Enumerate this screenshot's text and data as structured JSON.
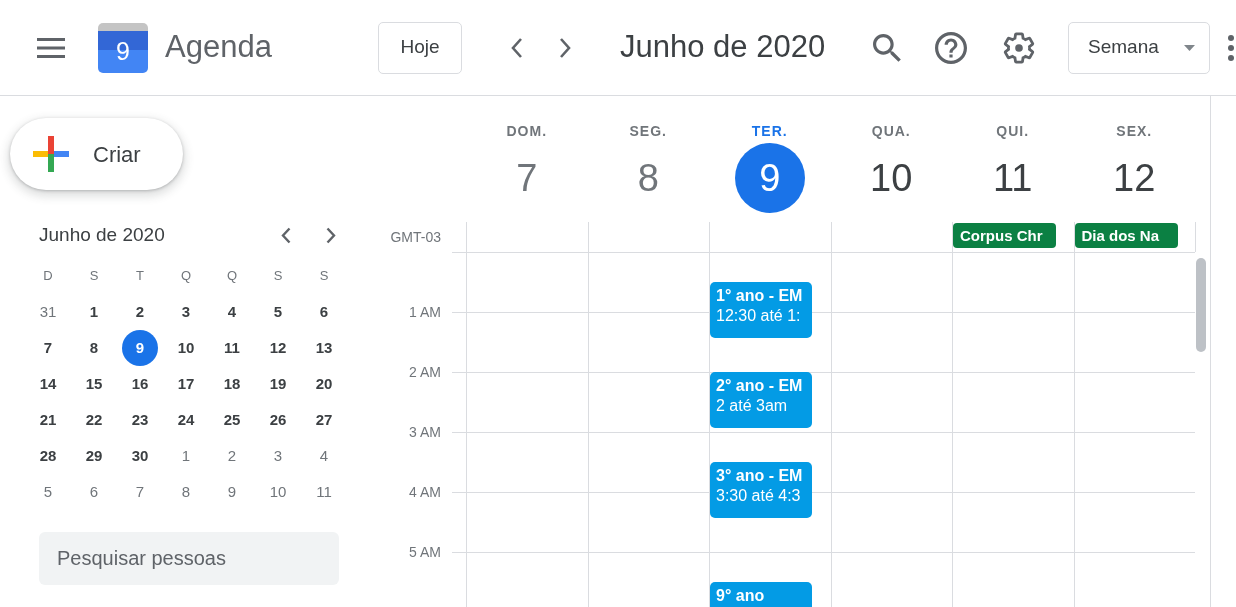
{
  "header": {
    "logo_day": "9",
    "app_name": "Agenda",
    "today_button": "Hoje",
    "period_title": "Junho de 2020",
    "view_select": "Semana"
  },
  "sidebar": {
    "create_button": "Criar",
    "mini_calendar": {
      "title": "Junho de 2020",
      "weekdays": [
        "D",
        "S",
        "T",
        "Q",
        "Q",
        "S",
        "S"
      ],
      "weeks": [
        [
          {
            "day": "31",
            "in_month": false,
            "selected": false
          },
          {
            "day": "1",
            "in_month": true,
            "selected": false
          },
          {
            "day": "2",
            "in_month": true,
            "selected": false
          },
          {
            "day": "3",
            "in_month": true,
            "selected": false
          },
          {
            "day": "4",
            "in_month": true,
            "selected": false
          },
          {
            "day": "5",
            "in_month": true,
            "selected": false
          },
          {
            "day": "6",
            "in_month": true,
            "selected": false
          }
        ],
        [
          {
            "day": "7",
            "in_month": true,
            "selected": false
          },
          {
            "day": "8",
            "in_month": true,
            "selected": false
          },
          {
            "day": "9",
            "in_month": true,
            "selected": true
          },
          {
            "day": "10",
            "in_month": true,
            "selected": false
          },
          {
            "day": "11",
            "in_month": true,
            "selected": false
          },
          {
            "day": "12",
            "in_month": true,
            "selected": false
          },
          {
            "day": "13",
            "in_month": true,
            "selected": false
          }
        ],
        [
          {
            "day": "14",
            "in_month": true,
            "selected": false
          },
          {
            "day": "15",
            "in_month": true,
            "selected": false
          },
          {
            "day": "16",
            "in_month": true,
            "selected": false
          },
          {
            "day": "17",
            "in_month": true,
            "selected": false
          },
          {
            "day": "18",
            "in_month": true,
            "selected": false
          },
          {
            "day": "19",
            "in_month": true,
            "selected": false
          },
          {
            "day": "20",
            "in_month": true,
            "selected": false
          }
        ],
        [
          {
            "day": "21",
            "in_month": true,
            "selected": false
          },
          {
            "day": "22",
            "in_month": true,
            "selected": false
          },
          {
            "day": "23",
            "in_month": true,
            "selected": false
          },
          {
            "day": "24",
            "in_month": true,
            "selected": false
          },
          {
            "day": "25",
            "in_month": true,
            "selected": false
          },
          {
            "day": "26",
            "in_month": true,
            "selected": false
          },
          {
            "day": "27",
            "in_month": true,
            "selected": false
          }
        ],
        [
          {
            "day": "28",
            "in_month": true,
            "selected": false
          },
          {
            "day": "29",
            "in_month": true,
            "selected": false
          },
          {
            "day": "30",
            "in_month": true,
            "selected": false
          },
          {
            "day": "1",
            "in_month": false,
            "selected": false
          },
          {
            "day": "2",
            "in_month": false,
            "selected": false
          },
          {
            "day": "3",
            "in_month": false,
            "selected": false
          },
          {
            "day": "4",
            "in_month": false,
            "selected": false
          }
        ],
        [
          {
            "day": "5",
            "in_month": false,
            "selected": false
          },
          {
            "day": "6",
            "in_month": false,
            "selected": false
          },
          {
            "day": "7",
            "in_month": false,
            "selected": false
          },
          {
            "day": "8",
            "in_month": false,
            "selected": false
          },
          {
            "day": "9",
            "in_month": false,
            "selected": false
          },
          {
            "day": "10",
            "in_month": false,
            "selected": false
          },
          {
            "day": "11",
            "in_month": false,
            "selected": false
          }
        ]
      ]
    },
    "people_search": {
      "placeholder": "Pesquisar pessoas"
    }
  },
  "week_view": {
    "timezone": "GMT-03",
    "days": [
      {
        "weekday": "DOM.",
        "date": "7",
        "past": true,
        "selected": false
      },
      {
        "weekday": "SEG.",
        "date": "8",
        "past": true,
        "selected": false
      },
      {
        "weekday": "TER.",
        "date": "9",
        "past": false,
        "selected": true,
        "timeline": [
          {
            "kind": "gap"
          },
          {
            "kind": "event",
            "title": "1° ano - EM",
            "time": "12:30 até 1:",
            "color": "#039be5"
          },
          {
            "kind": "gap"
          },
          {
            "kind": "event",
            "title": "2° ano - EM",
            "time": "2 até 3am",
            "color": "#039be5"
          },
          {
            "kind": "gap"
          },
          {
            "kind": "event",
            "title": "3° ano - EM",
            "time": "3:30 até 4:3",
            "color": "#039be5"
          },
          {
            "kind": "gap"
          },
          {
            "kind": "gap"
          },
          {
            "kind": "event",
            "title": "9° ano",
            "color": "#039be5"
          }
        ]
      },
      {
        "weekday": "QUA.",
        "date": "10",
        "past": false,
        "selected": false
      },
      {
        "weekday": "QUI.",
        "date": "11",
        "past": false,
        "selected": false,
        "all_day_events": [
          {
            "title": "Corpus Chr",
            "color": "#0b8043"
          }
        ]
      },
      {
        "weekday": "SEX.",
        "date": "12",
        "past": false,
        "selected": false,
        "all_day_events": [
          {
            "title": "Dia dos Na",
            "color": "#0b8043"
          }
        ]
      }
    ],
    "hour_labels": [
      "1 AM",
      "2 AM",
      "3 AM",
      "4 AM",
      "5 AM"
    ]
  }
}
